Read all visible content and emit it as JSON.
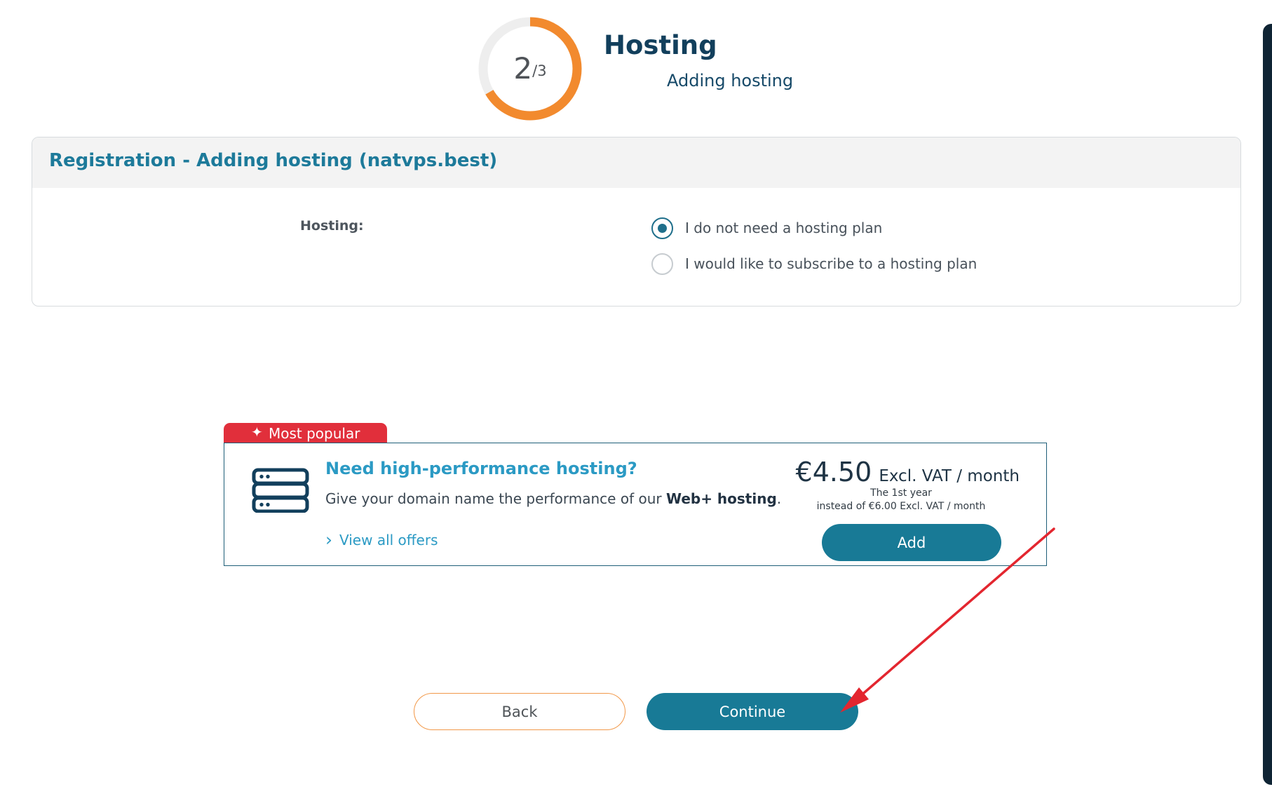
{
  "progress": {
    "current": "2",
    "total": "/3",
    "fraction": 0.6667,
    "accent_color": "#f28a2e",
    "track_color": "#eeeeee"
  },
  "step": {
    "title": "Hosting",
    "subtitle": "Adding hosting"
  },
  "registration": {
    "title": "Registration - Adding hosting (natvps.best)",
    "hosting_label": "Hosting:",
    "options": [
      {
        "label": "I do not need a hosting plan",
        "selected": true
      },
      {
        "label": "I would like to subscribe to a hosting plan",
        "selected": false
      }
    ]
  },
  "offer": {
    "badge_icon": "sparkle-icon",
    "badge_label": "Most popular",
    "server_icon": "server-icon",
    "title": "Need high-performance hosting?",
    "description_prefix": "Give your domain name the performance of our ",
    "description_product": "Web+ hosting",
    "description_suffix": ".",
    "link_icon": "chevron-right-icon",
    "link_label": "View all offers",
    "price": "€4.50",
    "price_unit": "Excl. VAT / month",
    "price_period": "The 1st year",
    "price_original": "instead of €6.00 Excl. VAT / month",
    "add_label": "Add",
    "badge_color": "#e12f3b",
    "button_color": "#187a96"
  },
  "navigation": {
    "back_label": "Back",
    "continue_label": "Continue"
  },
  "annotation": {
    "icon": "red-arrow-icon",
    "color": "#e3262f"
  }
}
